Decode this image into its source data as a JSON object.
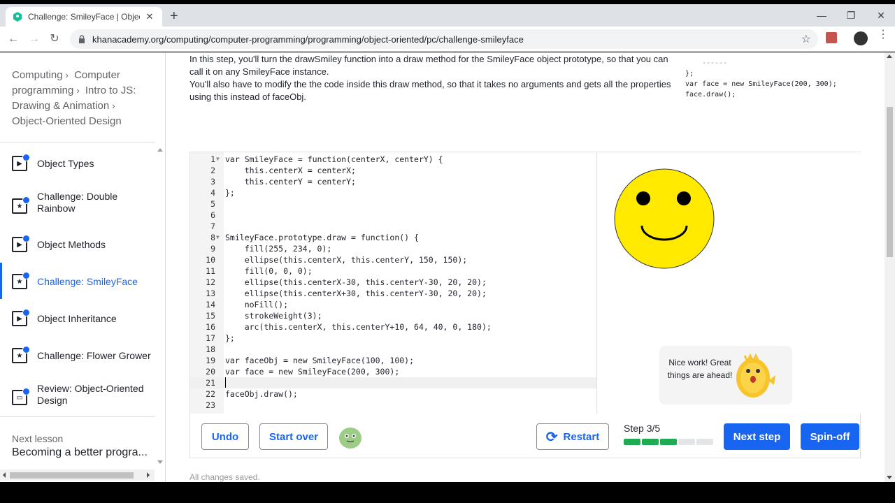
{
  "browser": {
    "tab_title": "Challenge: SmileyFace | Object-O",
    "tab_close": "✕",
    "new_tab": "+",
    "url": "khanacademy.org/computing/computer-programming/programming/object-oriented/pc/challenge-smileyface",
    "icons": [
      "khan-favicon-icon",
      "back-icon",
      "forward-icon",
      "reload-icon",
      "lock-icon",
      "star-icon",
      "pdf-extension-icon",
      "profile-avatar",
      "menu-icon",
      "minimize-icon",
      "maximize-icon",
      "close-icon"
    ]
  },
  "sidebar": {
    "breadcrumb": [
      "Computing",
      "Computer programming",
      "Intro to JS: Drawing & Animation",
      "Object-Oriented Design"
    ],
    "items": [
      {
        "label": "Object Types",
        "type": "video"
      },
      {
        "label": "Challenge: Double Rainbow",
        "type": "challenge"
      },
      {
        "label": "Object Methods",
        "type": "video"
      },
      {
        "label": "Challenge: SmileyFace",
        "type": "challenge",
        "active": true
      },
      {
        "label": "Object Inheritance",
        "type": "video"
      },
      {
        "label": "Challenge: Flower Grower",
        "type": "challenge"
      },
      {
        "label": "Review: Object-Oriented Design",
        "type": "article"
      }
    ],
    "next_lesson_title": "Next lesson",
    "next_lesson_name": "Becoming a better progra..."
  },
  "instructions": {
    "p1": "In this step, you'll turn the drawSmiley function into a draw method for the SmileyFace object prototype, so that you can call it on any SmileyFace instance.",
    "p2": "You'll also have to modify the the code inside this draw method, so that it takes no arguments and gets all the properties using this instead of faceObj.",
    "hint_code": [
      "------",
      "};",
      "var face = new SmileyFace(200, 300);",
      "face.draw();"
    ]
  },
  "editor": {
    "lines": [
      "var SmileyFace = function(centerX, centerY) {",
      "    this.centerX = centerX;",
      "    this.centerY = centerY;",
      "};",
      "",
      "",
      "",
      "SmileyFace.prototype.draw = function() {",
      "    fill(255, 234, 0);",
      "    ellipse(this.centerX, this.centerY, 150, 150);",
      "    fill(0, 0, 0);",
      "    ellipse(this.centerX-30, this.centerY-30, 20, 20);",
      "    ellipse(this.centerX+30, this.centerY-30, 20, 20);",
      "    noFill();",
      "    strokeWeight(3);",
      "    arc(this.centerX, this.centerY+10, 64, 40, 0, 180);",
      "};",
      "",
      "var faceObj = new SmileyFace(100, 100);",
      "var face = new SmileyFace(200, 300);",
      "",
      "faceObj.draw();",
      ""
    ],
    "current_line": 21,
    "fold_lines": [
      1,
      8
    ]
  },
  "toast": {
    "text": "Nice work! Great things are ahead!"
  },
  "toolbar": {
    "undo": "Undo",
    "start_over": "Start over",
    "restart": "Restart",
    "step_label": "Step 3/5",
    "steps_done": 3,
    "steps_total": 5,
    "next_step": "Next step",
    "spin_off": "Spin-off"
  },
  "status": {
    "saved": "All changes saved."
  },
  "colors": {
    "accent": "#1865f2",
    "progress": "#1fab54",
    "smiley_fill": "#ffea00"
  }
}
